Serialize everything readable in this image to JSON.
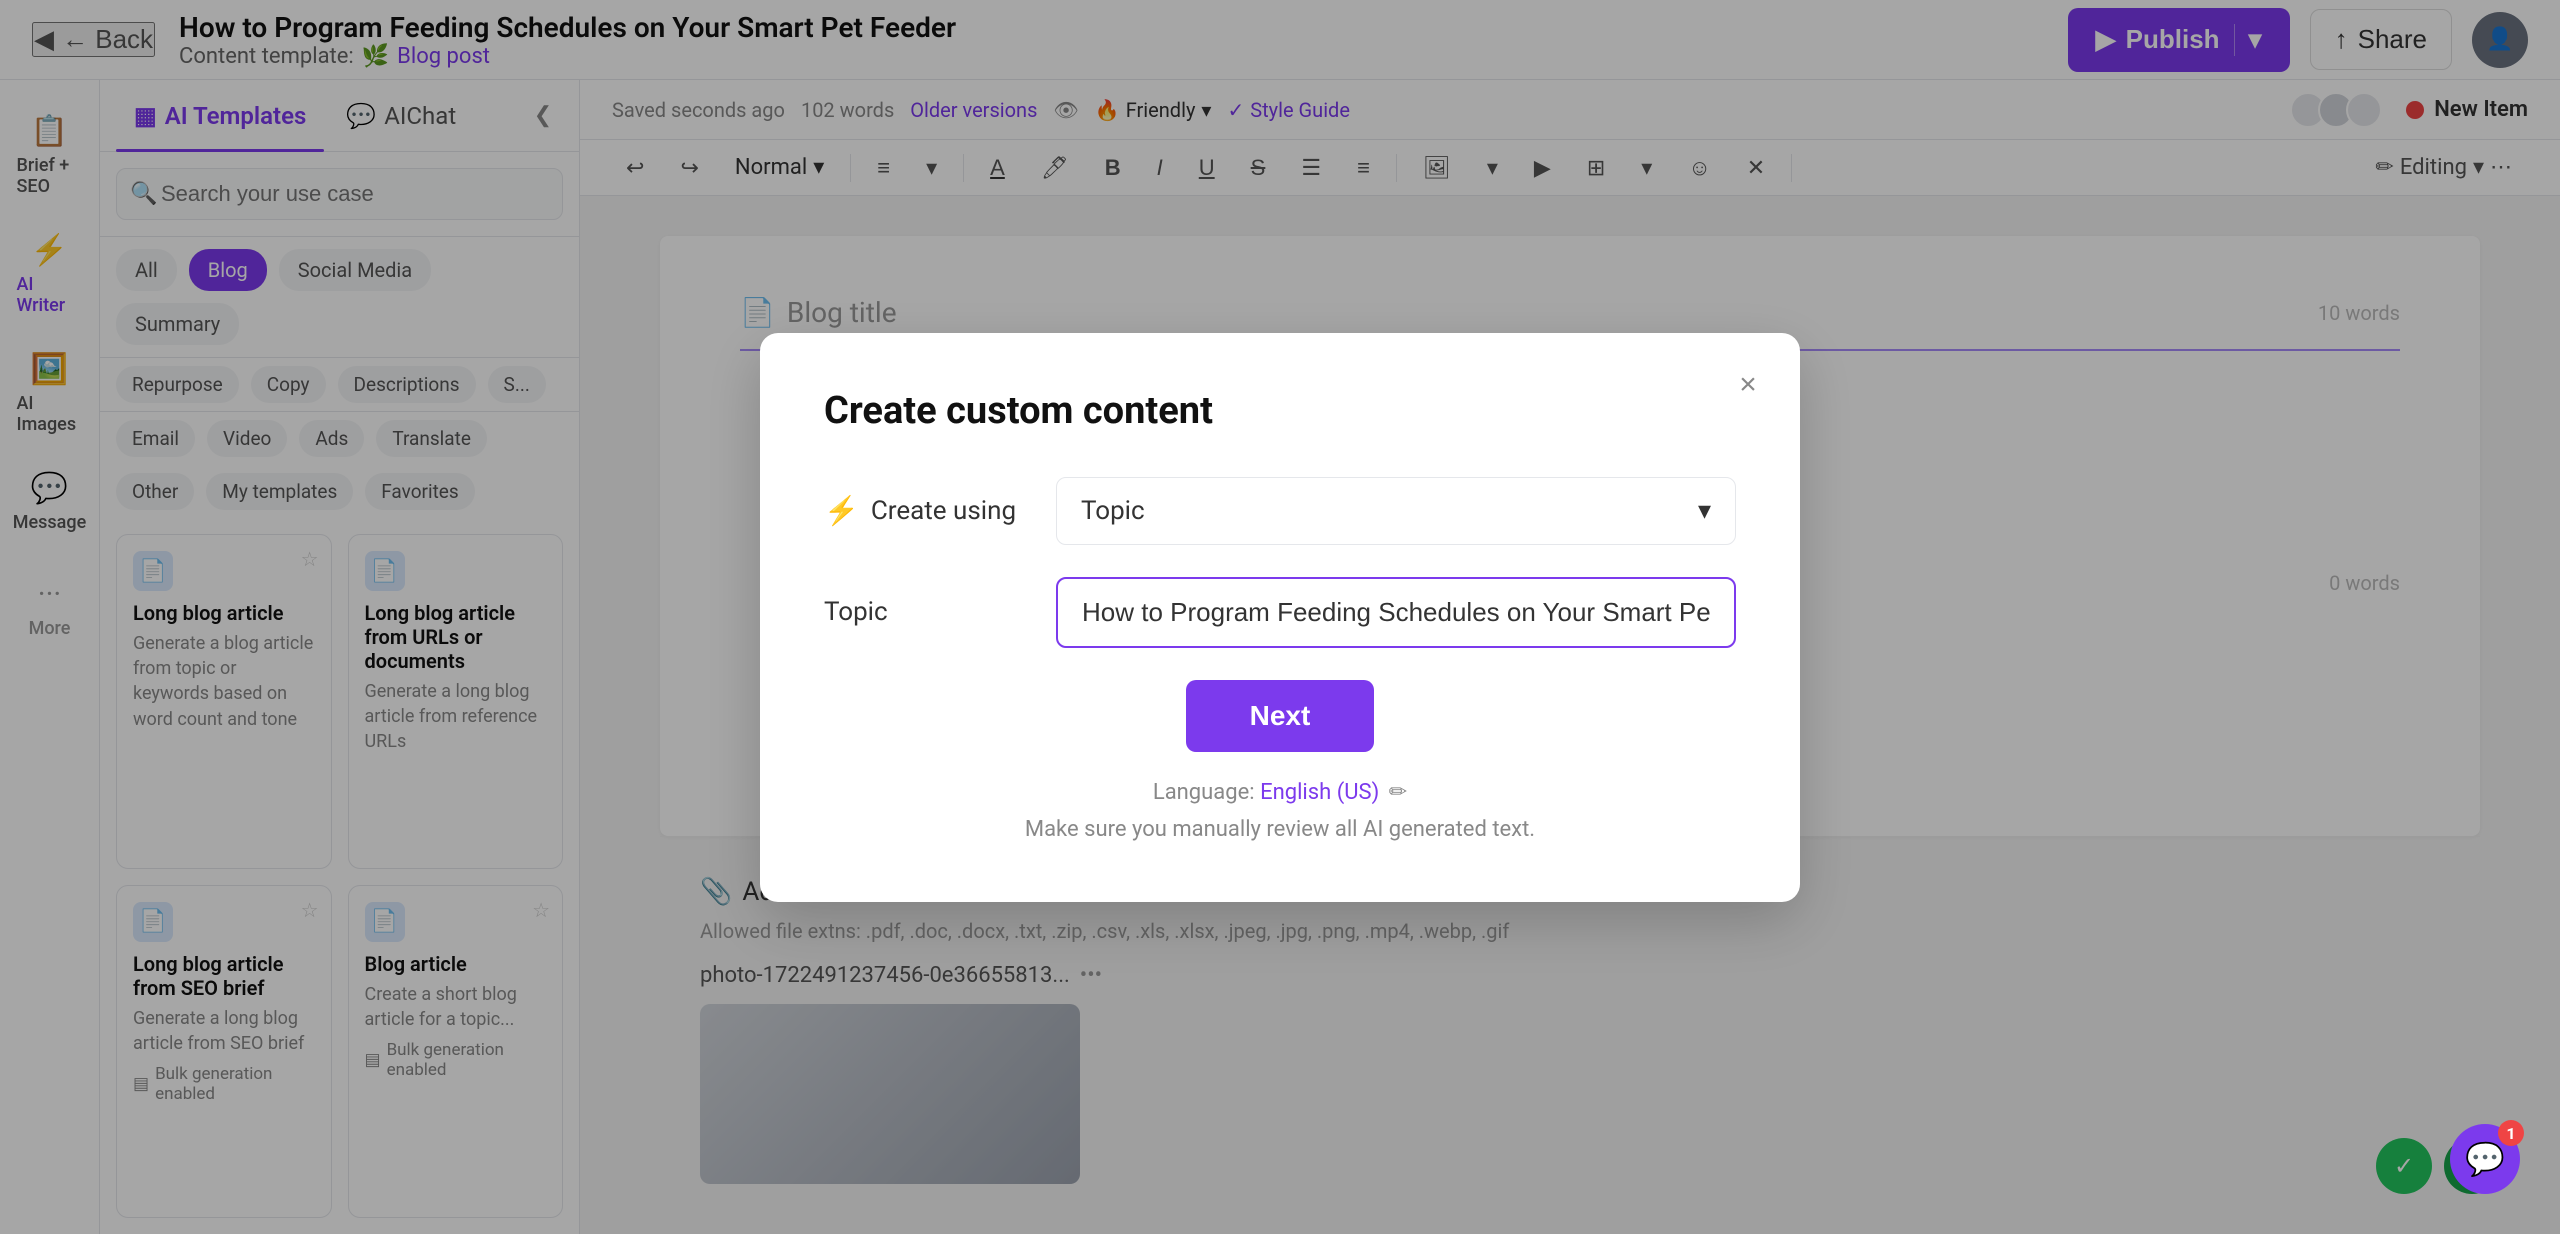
{
  "header": {
    "back_label": "← Back",
    "page_title": "How to Program Feeding Schedules on Your Smart Pet Feeder",
    "content_template_label": "Content template:",
    "blog_post_link": "Blog post",
    "publish_label": "Publish",
    "share_label": "Share"
  },
  "sidebar": {
    "items": [
      {
        "id": "brief-seo",
        "icon": "📋",
        "label": "Brief + SEO"
      },
      {
        "id": "ai-writer",
        "icon": "⚡",
        "label": "AI Writer",
        "active": true
      },
      {
        "id": "ai-images",
        "icon": "🖼️",
        "label": "AI Images"
      },
      {
        "id": "message",
        "icon": "💬",
        "label": "Message"
      },
      {
        "id": "more",
        "icon": "...",
        "label": "More"
      }
    ]
  },
  "ai_panel": {
    "tab_templates": "AI Templates",
    "tab_chat": "AIChat",
    "search_placeholder": "Search your use case",
    "filters_row1": [
      "All",
      "Blog",
      "Social Media",
      "Summary"
    ],
    "filters_row2": [
      "Repurpose",
      "Copy",
      "Descriptions",
      "S..."
    ],
    "filters_row3": [
      "Email",
      "Video",
      "Ads",
      "Translate"
    ],
    "filters_row4": [
      "Other",
      "My templates",
      "Favorites"
    ],
    "templates": [
      {
        "icon": "📄",
        "name": "Long blog article",
        "desc": "Generate a blog article from topic or keywords based on word count and tone",
        "starred": false
      },
      {
        "icon": "📄",
        "name": "Long blog article from URLs or documents",
        "desc": "Generate a long blog article from reference URLs",
        "starred": false
      },
      {
        "icon": "📄",
        "name": "Long blog article from SEO brief",
        "desc": "Generate a long blog article from SEO brief",
        "starred": false,
        "bulk": true,
        "bulk_label": "Bulk generation enabled"
      },
      {
        "icon": "📄",
        "name": "Blog article",
        "desc": "Create a short blog article for a topic...",
        "starred": false,
        "bulk": true,
        "bulk_label": "Bulk generation enabled"
      }
    ]
  },
  "editor": {
    "saved_label": "Saved seconds ago",
    "words_label": "102 words",
    "older_versions_label": "Older versions",
    "tone_label": "Friendly",
    "style_guide_label": "Style Guide",
    "format_label": "Normal",
    "editing_label": "Editing",
    "new_item_label": "New Item",
    "blog_title_placeholder": "Blog title",
    "word_count_right": "10 words",
    "word_count_right2": "0 words",
    "attachments_title": "Add attachments",
    "attachments_desc": "Allowed file extns: .pdf, .doc, .docx, .txt, .zip, .csv, .xls, .xlsx, .jpeg, .jpg, .png, .mp4, .webp, .gif",
    "attachment_filename": "photo-1722491237456-0e36655813...",
    "attachment_menu": "•••"
  },
  "modal": {
    "title": "Create custom content",
    "close_icon": "×",
    "create_using_label": "Create using",
    "create_using_icon": "⚡",
    "create_using_value": "Topic",
    "topic_label": "Topic",
    "topic_value": "How to Program Feeding Schedules on Your Smart Pet Feeder",
    "next_button": "Next",
    "language_label": "Language:",
    "language_value": "English (US)",
    "disclaimer": "Make sure you manually review all AI generated text."
  },
  "chat": {
    "icon": "💬",
    "badge": "1"
  }
}
